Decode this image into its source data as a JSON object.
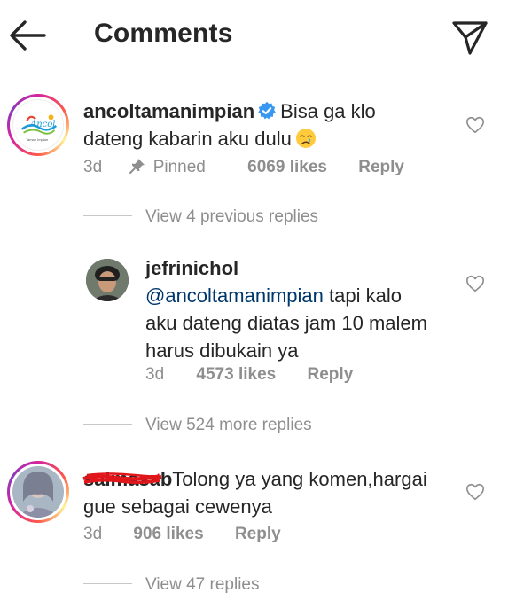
{
  "header": {
    "title": "Comments",
    "back_icon": "arrow-left-icon",
    "send_icon": "paper-plane-icon"
  },
  "comments": [
    {
      "username": "ancoltamanimpian",
      "verified": true,
      "text_line1": "Bisa ga klo",
      "text_line2": "dateng kabarin aku dulu",
      "time": "3d",
      "pinned_label": "Pinned",
      "likes": "6069 likes",
      "reply_label": "Reply",
      "view_replies": "View 4 previous replies"
    },
    {
      "username": "jefrinichol",
      "mention": "@ancoltamanimpian",
      "text_line1": "tapi kalo",
      "text_line2": "aku dateng diatas jam 10 malem",
      "text_line3": "harus dibukain ya",
      "time": "3d",
      "likes": "4573 likes",
      "reply_label": "Reply",
      "view_replies": "View 524 more replies"
    },
    {
      "username_redacted": "salmasab",
      "text_line1": "Tolong ya yang komen,hargai",
      "text_line2": "gue sebagai cewenya",
      "time": "3d",
      "likes": "906 likes",
      "reply_label": "Reply",
      "view_replies": "View 47 replies"
    }
  ],
  "avatar_logo_text": "Ancol",
  "avatar_logo_subtext": "Taman Impian",
  "colors": {
    "text": "#262626",
    "secondary": "#8e8e8e",
    "mention": "#00376b",
    "verified": "#3897f0",
    "redaction": "#e0161a"
  }
}
